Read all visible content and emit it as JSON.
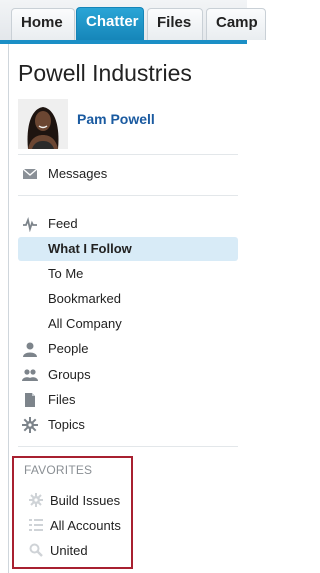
{
  "tabs": [
    {
      "label": "Home"
    },
    {
      "label": "Chatter",
      "active": true
    },
    {
      "label": "Files"
    },
    {
      "label": "Camp"
    }
  ],
  "page": {
    "title": "Powell Industries"
  },
  "user": {
    "name": "Pam Powell"
  },
  "nav": {
    "messages": "Messages",
    "feed": "Feed",
    "feed_items": [
      "What I Follow",
      "To Me",
      "Bookmarked",
      "All Company"
    ],
    "selected": "What I Follow",
    "people": "People",
    "groups": "Groups",
    "files": "Files",
    "topics": "Topics"
  },
  "favorites": {
    "heading": "FAVORITES",
    "items": [
      "Build Issues",
      "All Accounts",
      "United"
    ]
  },
  "colors": {
    "accent": "#1b8fc6",
    "link": "#1a5aa0",
    "selected_bg": "#d8ebf7",
    "highlight_border": "#a82030"
  }
}
